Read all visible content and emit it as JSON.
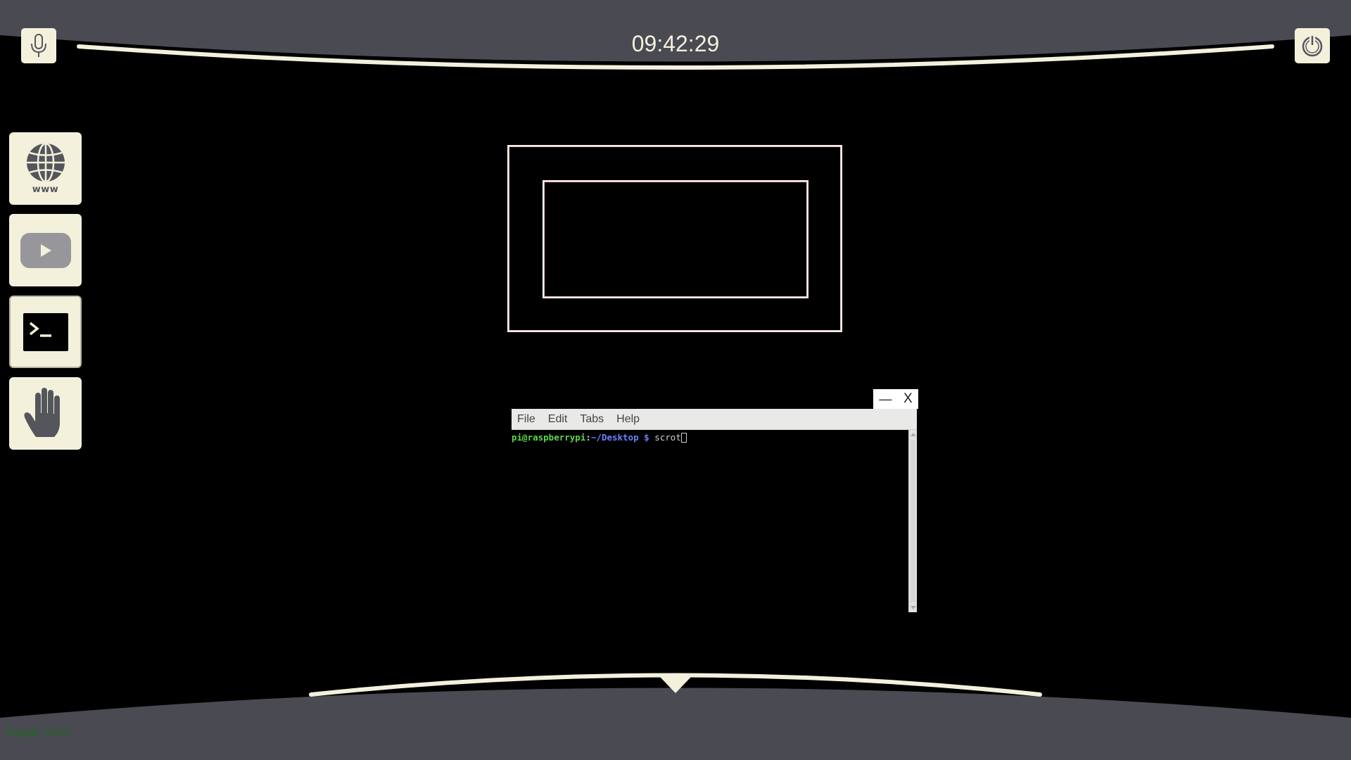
{
  "topbar": {
    "clock": "09:42:29",
    "mic_icon": "microphone-icon",
    "power_icon": "power-icon"
  },
  "dock": {
    "items": [
      {
        "name": "browser",
        "icon": "globe-icon",
        "label": "www"
      },
      {
        "name": "youtube",
        "icon": "youtube-icon"
      },
      {
        "name": "terminal",
        "icon": "terminal-icon"
      },
      {
        "name": "gesture",
        "icon": "hand-icon"
      }
    ]
  },
  "window": {
    "minimize_label": "—",
    "close_label": "X",
    "menu": [
      "File",
      "Edit",
      "Tabs",
      "Help"
    ]
  },
  "terminal": {
    "user_host": "pi@raspberrypi",
    "colon": ":",
    "path": "~/Desktop",
    "prompt_symbol": "$",
    "command": "scrot"
  },
  "status": {
    "text": "length: 0.107"
  },
  "colors": {
    "bar_gray": "#494a52",
    "cream": "#f3f1dc",
    "frame_pink": "#e8b9c0",
    "status_green": "#1e6a1e",
    "prompt_green": "#5ed54b",
    "prompt_blue": "#6d80ff"
  }
}
